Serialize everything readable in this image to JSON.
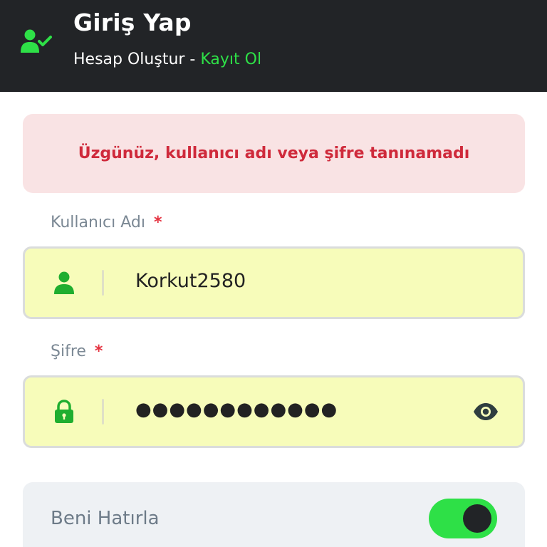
{
  "header": {
    "title": "Giriş Yap",
    "subtitle_prefix": "Hesap Oluştur - ",
    "subtitle_link": "Kayıt Ol",
    "icon": "user-check-icon"
  },
  "error": {
    "message": "Üzgünüz, kullanıcı adı veya şifre tanınamadı"
  },
  "username": {
    "label": "Kullanıcı Adı",
    "required_mark": "*",
    "value": "Korkut2580",
    "icon": "user-icon"
  },
  "password": {
    "label": "Şifre",
    "required_mark": "*",
    "masked_value": "●●●●●●●●●●●●",
    "icon": "lock-icon",
    "toggle_icon": "eye-icon"
  },
  "remember": {
    "label": "Beni Hatırla",
    "enabled": true
  },
  "colors": {
    "header_bg": "#222427",
    "accent_green": "#2ee047",
    "error_bg": "#f9e3e4",
    "error_text": "#cf2a3b",
    "field_bg": "#f7fcba"
  }
}
